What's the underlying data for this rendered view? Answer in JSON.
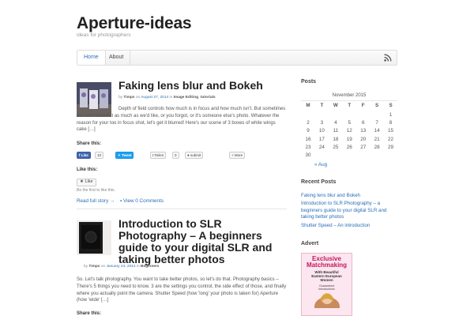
{
  "site": {
    "title": "Aperture-ideas",
    "tagline": "ideas for photographers"
  },
  "nav": {
    "items": [
      "Home",
      "About"
    ]
  },
  "posts": [
    {
      "title": "Faking lens blur and Bokeh",
      "meta": {
        "by": "by",
        "author": "Timps",
        "on": "on",
        "date": "August 27, 2014",
        "in": "in",
        "cat1": "Image Editing",
        "cat2": "tutorials"
      },
      "excerpt": "Depth of field controls how much is in focus and how much isn't. But sometimes we can't control it as much as we'd like, or you forgot, or it's someone else's photo. Whatever the reason for your too in focus shot, let's get it blurred! Here's our scene of 3 boxes of white wings cake […]",
      "share_label": "Share this:",
      "share": {
        "fb_like": "Like",
        "fb_count": "10",
        "tweet": "Tweet",
        "tumblr_count": "0",
        "reddit": "submit",
        "more": "More"
      },
      "like_label": "Like this:",
      "like_btn": "Like",
      "like_first": "Be the first to like this.",
      "read_full": "Read full story",
      "comments": "View 0 Comments"
    },
    {
      "title": "Introduction to SLR Photography – A beginners guide to your digital SLR and taking better photos",
      "meta": {
        "by": "by",
        "author": "Timps",
        "on": "on",
        "date": "January 24, 2014",
        "in": "in",
        "cat1": "Beginners"
      },
      "excerpt": "So. Let's talk photography. You want to take better photos, so let's do that. Photography basics – There's 5 things you need to know. 3 are the settings you control, the side effect of those, and finally where you actually point the camera. Shutter Speed (how 'long' your photo is taken for) Aperture (how 'wide' […]",
      "share_label": "Share this:"
    }
  ],
  "sidebar": {
    "posts_title": "Posts",
    "calendar": {
      "caption": "November 2015",
      "days": [
        "M",
        "T",
        "W",
        "T",
        "F",
        "S",
        "S"
      ],
      "weeks": [
        [
          "",
          "",
          "",
          "",
          "",
          "",
          "1"
        ],
        [
          "2",
          "3",
          "4",
          "5",
          "6",
          "7",
          "8"
        ],
        [
          "9",
          "10",
          "11",
          "12",
          "13",
          "14",
          "15"
        ],
        [
          "16",
          "17",
          "18",
          "19",
          "20",
          "21",
          "22"
        ],
        [
          "23",
          "24",
          "25",
          "26",
          "27",
          "28",
          "29"
        ],
        [
          "30",
          "",
          "",
          "",
          "",
          "",
          ""
        ]
      ],
      "prev": "« Aug"
    },
    "recent_title": "Recent Posts",
    "recent": [
      "Faking lens blur and Bokeh",
      "Introduction to SLR Photography – a beginners guide to your digital SLR and taking better photos",
      "Shutter Speed – An introduction"
    ],
    "advert_title": "Advert",
    "advert": {
      "headline1": "Exclusive",
      "headline2": "Matchmaking",
      "sub1": "With Beautiful",
      "sub2": "Eastern European",
      "sub3": "Women",
      "small1": "Guaranteed",
      "small2": "Introductions"
    }
  },
  "colors": {
    "link": "#2a6fb5",
    "accent_ad": "#c2185b"
  }
}
